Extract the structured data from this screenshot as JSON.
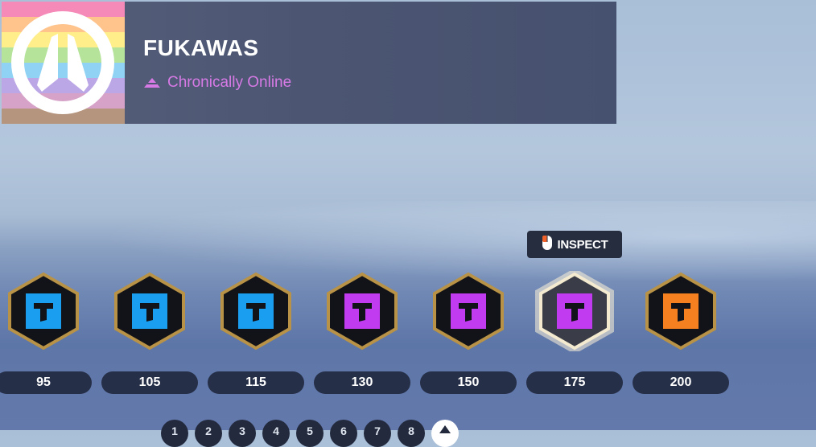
{
  "profile": {
    "name": "FUKAWAS",
    "title": "Chronically Online",
    "title_color": "#d77ae6",
    "avatar_stripes": [
      "#f58ab8",
      "#ffc38c",
      "#ffee8a",
      "#b5e39a",
      "#8fd2f4",
      "#bba6e6",
      "#d6a2c8",
      "#b5957e"
    ]
  },
  "tooltip": {
    "icon": "mouse-icon",
    "label": "INSPECT"
  },
  "icons": [
    {
      "value": "95",
      "color": "#1a9ef0",
      "selected": false
    },
    {
      "value": "105",
      "color": "#1a9ef0",
      "selected": false
    },
    {
      "value": "115",
      "color": "#1a9ef0",
      "selected": false
    },
    {
      "value": "130",
      "color": "#c13cf0",
      "selected": false
    },
    {
      "value": "150",
      "color": "#c13cf0",
      "selected": false
    },
    {
      "value": "175",
      "color": "#c13cf0",
      "selected": true
    },
    {
      "value": "200",
      "color": "#f58020",
      "selected": false
    }
  ],
  "pager": {
    "pages": [
      "1",
      "2",
      "3",
      "4",
      "5",
      "6",
      "7",
      "8"
    ],
    "active_icon": "chevron-up-icon"
  }
}
